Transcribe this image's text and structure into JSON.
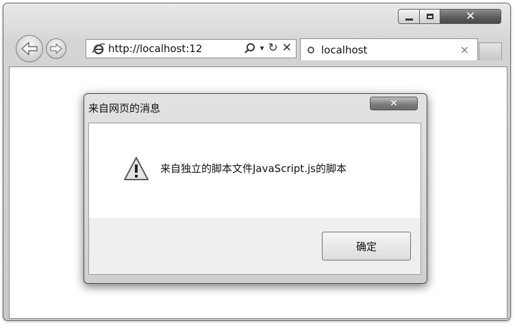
{
  "window": {
    "caption_buttons": [
      "minimize",
      "maximize",
      "close"
    ]
  },
  "nav": {
    "back_icon": "back-arrow-icon",
    "forward_icon": "forward-arrow-icon"
  },
  "address_bar": {
    "url": "http://localhost:12",
    "icon": "ie-logo-icon"
  },
  "tab": {
    "title": "localhost",
    "close_label": "×"
  },
  "dialog": {
    "title": "来自网页的消息",
    "message": "来自独立的脚本文件JavaScript.js的脚本",
    "ok_label": "确定",
    "icon": "warning-icon"
  }
}
